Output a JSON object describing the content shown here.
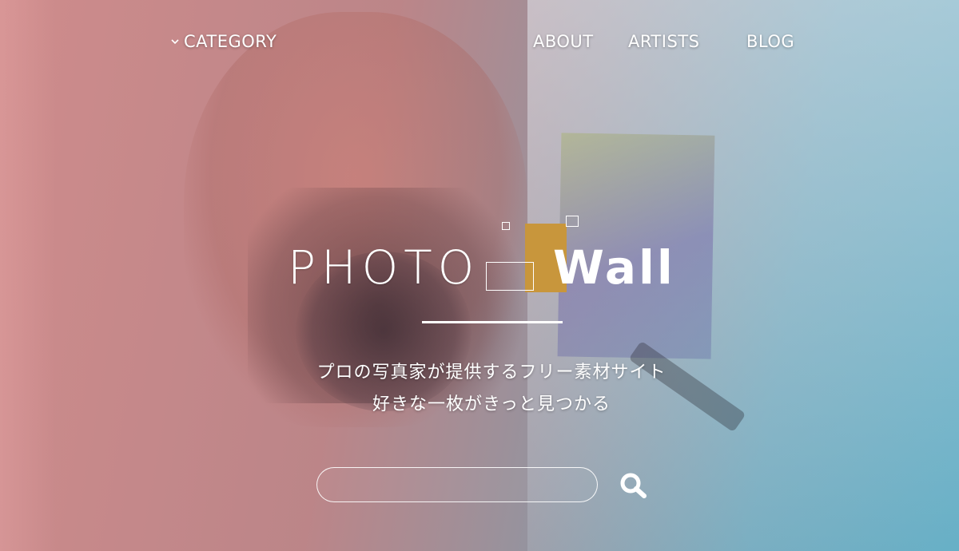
{
  "nav": {
    "category_label": "CATEGORY",
    "about_label": "ABOUT",
    "artists_label": "ARTISTS",
    "blog_label": "BLOG"
  },
  "logo": {
    "part1": "PHOTO",
    "part2": "Wall",
    "accent_color": "#C8963C"
  },
  "tagline": {
    "line1": "プロの写真家が提供するフリー素材サイト",
    "line2": "好きな一枚がきっと見つかる"
  },
  "search": {
    "value": "",
    "placeholder": ""
  },
  "icons": {
    "category_chevron": "chevron-down-icon",
    "search": "search-icon"
  }
}
